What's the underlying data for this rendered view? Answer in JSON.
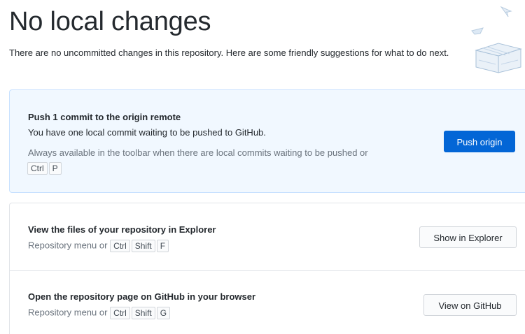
{
  "header": {
    "title": "No local changes",
    "subtitle": "There are no uncommitted changes in this repository. Here are some friendly suggestions for what to do next."
  },
  "push_card": {
    "heading": "Push 1 commit to the origin remote",
    "description": "You have one local commit waiting to be pushed to GitHub.",
    "hint": "Always available in the toolbar when there are local commits waiting to be pushed or",
    "shortcut": [
      "Ctrl",
      "P"
    ],
    "button_label": "Push origin"
  },
  "explorer_card": {
    "heading": "View the files of your repository in Explorer",
    "hint": "Repository menu or",
    "shortcut": [
      "Ctrl",
      "Shift",
      "F"
    ],
    "button_label": "Show in Explorer"
  },
  "github_card": {
    "heading": "Open the repository page on GitHub in your browser",
    "hint": "Repository menu or",
    "shortcut": [
      "Ctrl",
      "Shift",
      "G"
    ],
    "button_label": "View on GitHub"
  },
  "colors": {
    "accent": "#0366d6",
    "push_card_background": "#f1f8ff",
    "muted_text": "#6a737d"
  },
  "icons": [
    "paper-plane-icon",
    "paper-boat-icon",
    "gift-box-icon"
  ]
}
